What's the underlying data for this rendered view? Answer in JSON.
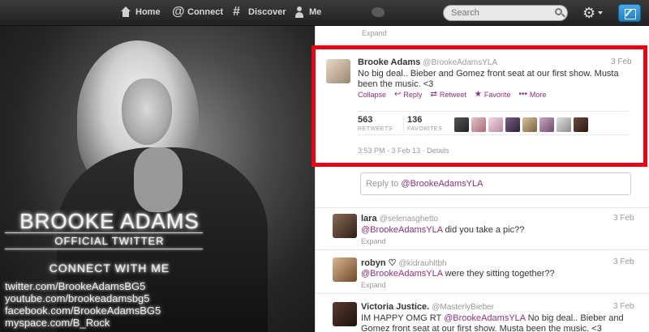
{
  "nav": {
    "home": "Home",
    "connect": "Connect",
    "discover": "Discover",
    "me": "Me",
    "search_placeholder": "Search"
  },
  "profile_bg": {
    "name": "BROOKE ADAMS",
    "subtitle": "OFFICIAL TWITTER",
    "connect": "CONNECT WITH ME",
    "links": [
      "twitter.com/BrookeAdamsBG5",
      "youtube.com/brookeadamsbg5",
      "facebook.com/BrookeAdamsBG5",
      "myspace.com/B_Rock"
    ]
  },
  "prev_expand": "Expand",
  "focused_tweet": {
    "name": "Brooke Adams",
    "handle": "@BrookeAdamsYLA",
    "date": "3 Feb",
    "text": "No big deal.. Bieber and Gomez front seat at our first show. Musta been the music. <3",
    "actions": {
      "collapse": "Collapse",
      "reply": "Reply",
      "retweet": "Retweet",
      "favorite": "Favorite",
      "more": "More"
    },
    "retweets": "563",
    "retweets_label": "RETWEETS",
    "favorites": "136",
    "favorites_label": "FAVORITES",
    "time": "3:53 PM - 3 Feb 13",
    "details": "Details"
  },
  "reply_box": {
    "prefix": "Reply to ",
    "mention": "@BrookeAdamsYLA"
  },
  "replies": [
    {
      "name": "lara",
      "handle": "@selenasghetto",
      "date": "3 Feb",
      "mention": "@BrookeAdamsYLA",
      "text": " did you take a pic??",
      "expand": "Expand"
    },
    {
      "name": "robyn ♡",
      "handle": "@kidrauhltbh",
      "date": "3 Feb",
      "mention": "@BrookeAdamsYLA",
      "text": " were they sitting together??",
      "expand": "Expand"
    },
    {
      "name": "Victoria Justice.",
      "handle": "@MasterlyBieber",
      "date": "3 Feb",
      "prefix": "IM HAPPY OMG RT ",
      "mention": "@BrookeAdamsYLA",
      "text": " No big deal.. Bieber and Gomez front seat at our first show. Musta been the music. <3"
    }
  ],
  "colors": {
    "highlight": "#e30613",
    "link": "#8d2f7e",
    "compose": "#2b8fd6"
  }
}
